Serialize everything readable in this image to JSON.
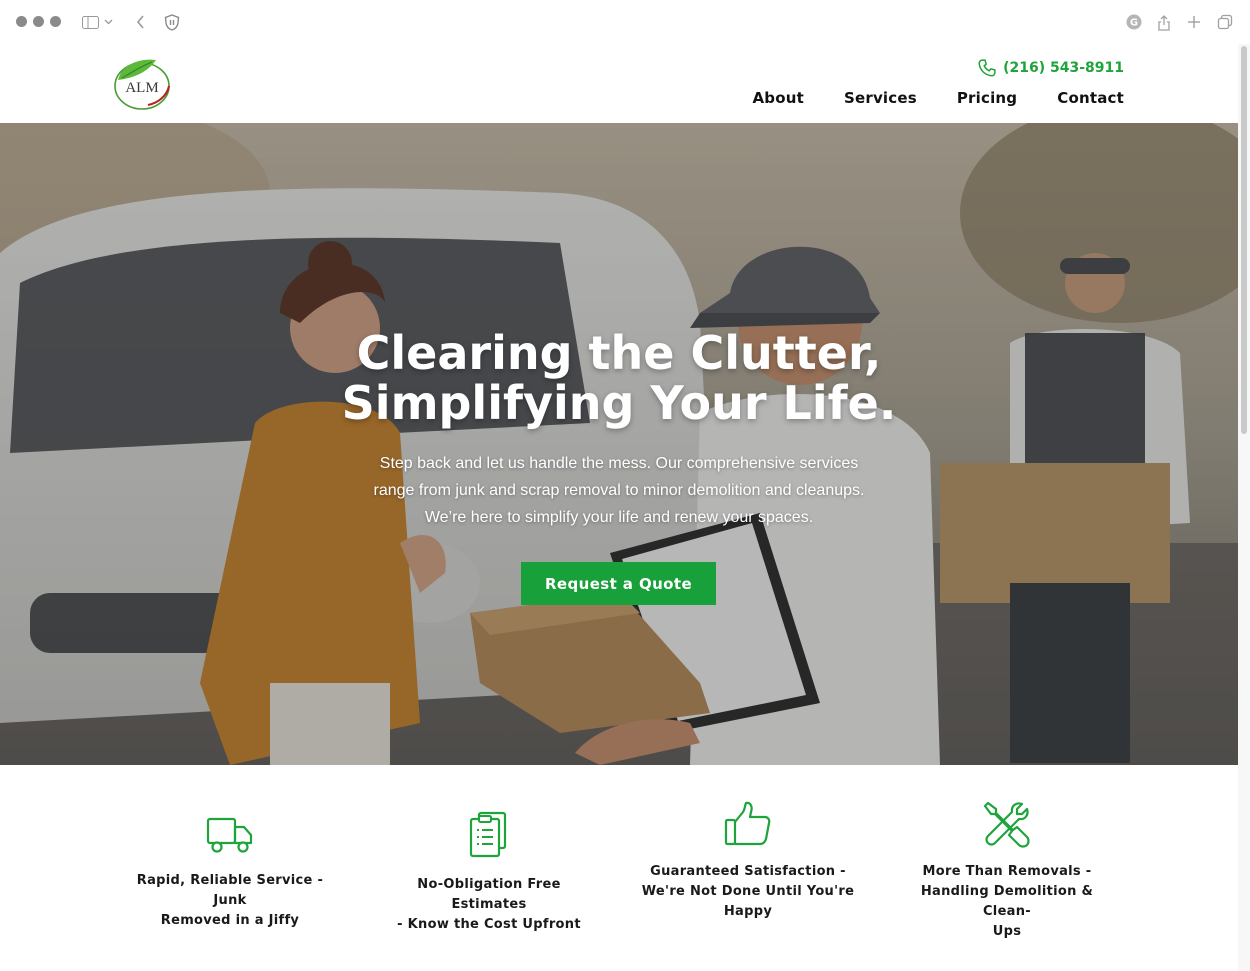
{
  "browser": {
    "icons": [
      "sidebar-icon",
      "chevron-down-icon",
      "back-icon",
      "shield-icon",
      "grammarly-icon",
      "share-icon",
      "new-tab-icon",
      "tabs-overview-icon"
    ]
  },
  "header": {
    "logo_text": "ALM",
    "phone": "(216) 543-8911",
    "nav": [
      {
        "label": "About"
      },
      {
        "label": "Services"
      },
      {
        "label": "Pricing"
      },
      {
        "label": "Contact"
      }
    ]
  },
  "hero": {
    "title_line1": "Clearing the Clutter,",
    "title_line2": "Simplifying Your Life.",
    "subtitle_line1": "Step back and let us handle the mess. Our comprehensive services",
    "subtitle_line2": "range from junk and scrap removal to minor demolition and cleanups.",
    "subtitle_line3": "We’re here to simplify your life and renew your spaces.",
    "cta_label": "Request a Quote"
  },
  "features": [
    {
      "icon": "truck-icon",
      "lines": [
        "Rapid, Reliable Service - Junk",
        "Removed in a Jiffy"
      ]
    },
    {
      "icon": "clipboard-icon",
      "lines": [
        "No-Obligation Free Estimates",
        "- Know the Cost Upfront"
      ]
    },
    {
      "icon": "thumbs-up-icon",
      "lines": [
        "Guaranteed Satisfaction -",
        "We're Not Done Until You're",
        "Happy"
      ]
    },
    {
      "icon": "tools-icon",
      "lines": [
        "More Than Removals -",
        "Handling Demolition & Clean-",
        "Ups"
      ]
    }
  ],
  "colors": {
    "brand_green": "#18a03a",
    "text_dark": "#111111"
  }
}
